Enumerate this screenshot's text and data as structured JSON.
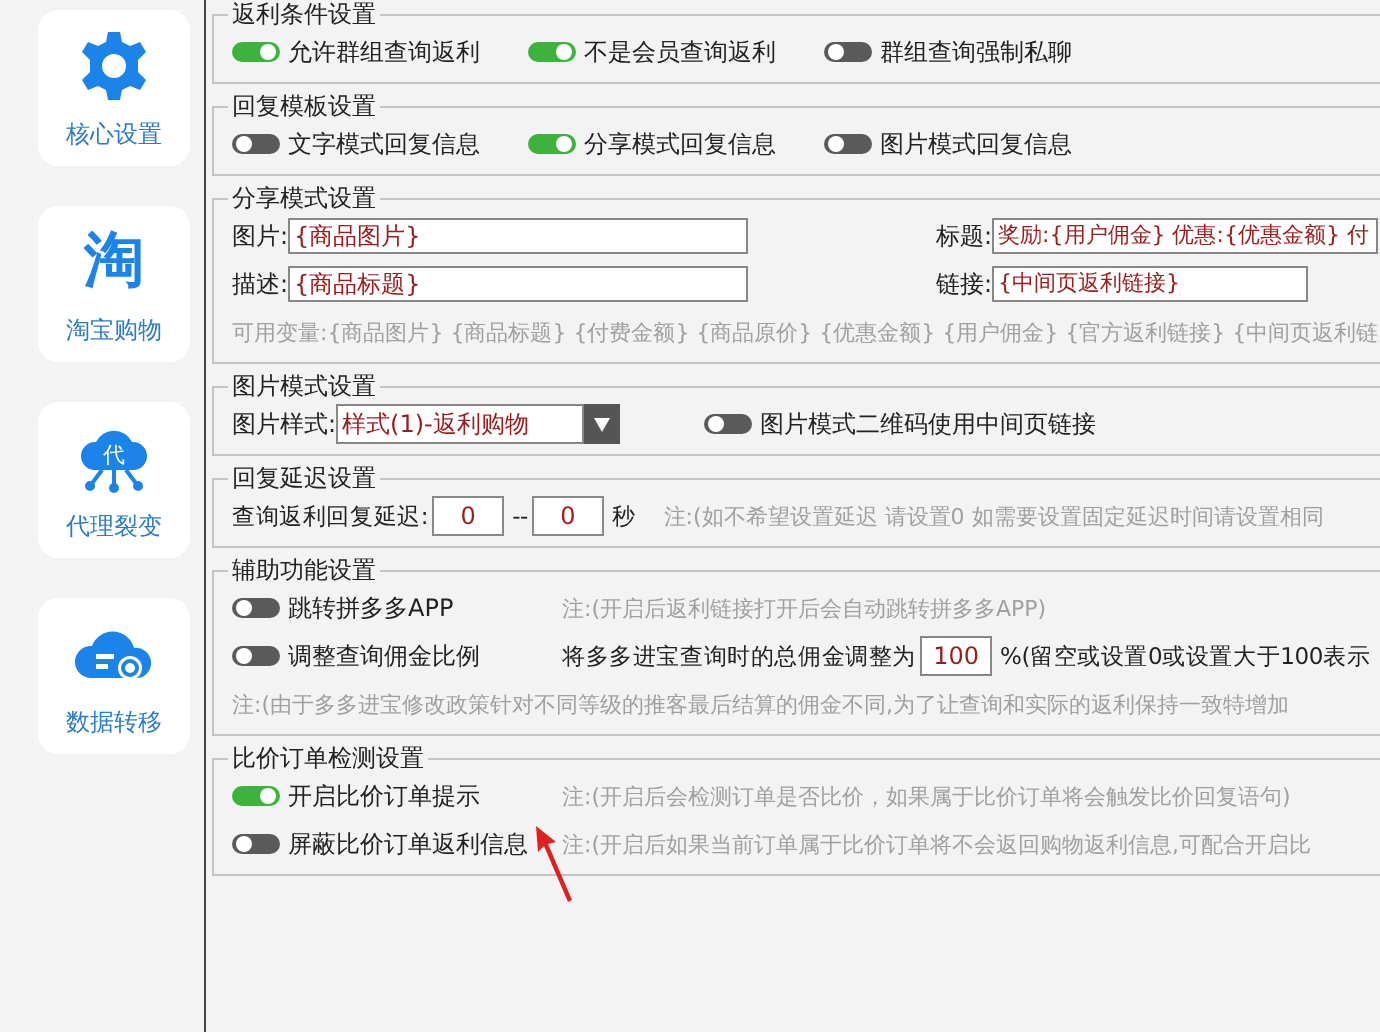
{
  "sidebar": {
    "items": [
      {
        "label": "核心设置"
      },
      {
        "label": "淘宝购物",
        "glyph": "淘"
      },
      {
        "label": "代理裂变",
        "glyph": "代"
      },
      {
        "label": "数据转移"
      }
    ]
  },
  "sections": [
    {
      "title": "返利条件设置",
      "rows": [
        [
          {
            "kind": "toggle",
            "label": "允许群组查询返利",
            "on": true
          },
          {
            "kind": "toggle",
            "label": "不是会员查询返利",
            "on": true
          },
          {
            "kind": "toggle",
            "label": "群组查询强制私聊",
            "on": false
          }
        ]
      ]
    },
    {
      "title": "回复模板设置",
      "rows": [
        [
          {
            "kind": "toggle",
            "label": "文字模式回复信息",
            "on": false
          },
          {
            "kind": "toggle",
            "label": "分享模式回复信息",
            "on": true
          },
          {
            "kind": "toggle",
            "label": "图片模式回复信息",
            "on": false
          }
        ]
      ]
    },
    {
      "title": "分享模式设置",
      "rows": [
        [
          {
            "kind": "field",
            "label": "图片:",
            "value": "{商品图片}"
          },
          {
            "kind": "field",
            "label": "标题:",
            "value": "奖励:{用户佣金} 优惠:{优惠金额} 付"
          }
        ],
        [
          {
            "kind": "field",
            "label": "描述:",
            "value": "{商品标题}"
          },
          {
            "kind": "field",
            "label": "链接:",
            "value": "{中间页返利链接}"
          }
        ],
        [
          {
            "kind": "note",
            "text": "可用变量:{商品图片} {商品标题} {付费金额} {商品原价} {优惠金额} {用户佣金} {官方返利链接} {中间页返利链"
          }
        ]
      ]
    },
    {
      "title": "图片模式设置",
      "rows": [
        [
          {
            "kind": "select",
            "label": "图片样式:",
            "value": "样式(1)-返利购物"
          },
          {
            "kind": "toggle",
            "label": "图片模式二维码使用中间页链接",
            "on": false
          }
        ]
      ]
    },
    {
      "title": "回复延迟设置",
      "rows": [
        [
          {
            "kind": "text",
            "text": "查询返利回复延迟:"
          },
          {
            "kind": "number",
            "value": "0"
          },
          {
            "kind": "text",
            "text": "--"
          },
          {
            "kind": "number",
            "value": "0"
          },
          {
            "kind": "text",
            "text": "秒"
          },
          {
            "kind": "note",
            "text": "注:(如不希望设置延迟 请设置0 如需要设置固定延迟时间请设置相同"
          }
        ]
      ]
    },
    {
      "title": "辅助功能设置",
      "rows": [
        [
          {
            "kind": "toggle",
            "label": "跳转拼多多APP",
            "on": false
          },
          {
            "kind": "note",
            "text": "注:(开启后返利链接打开后会自动跳转拼多多APP)"
          }
        ],
        [
          {
            "kind": "toggle",
            "label": "调整查询佣金比例",
            "on": false
          },
          {
            "kind": "text",
            "text": "将多多进宝查询时的总佣金调整为"
          },
          {
            "kind": "number",
            "value": "100"
          },
          {
            "kind": "text",
            "text": "%(留空或设置0或设置大于100表示"
          }
        ],
        [
          {
            "kind": "note",
            "text": "注:(由于多多进宝修改政策针对不同等级的推客最后结算的佣金不同,为了让查询和实际的返利保持一致特增加"
          }
        ]
      ]
    },
    {
      "title": "比价订单检测设置",
      "arrow": true,
      "rows": [
        [
          {
            "kind": "toggle",
            "label": "开启比价订单提示",
            "on": true
          },
          {
            "kind": "note",
            "text": "注:(开启后会检测订单是否比价，如果属于比价订单将会触发比价回复语句)"
          }
        ],
        [
          {
            "kind": "toggle",
            "label": "屏蔽比价订单返利信息",
            "on": false
          },
          {
            "kind": "note",
            "text": "注:(开启后如果当前订单属于比价订单将不会返回购物返利信息,可配合开启比"
          }
        ]
      ]
    }
  ]
}
